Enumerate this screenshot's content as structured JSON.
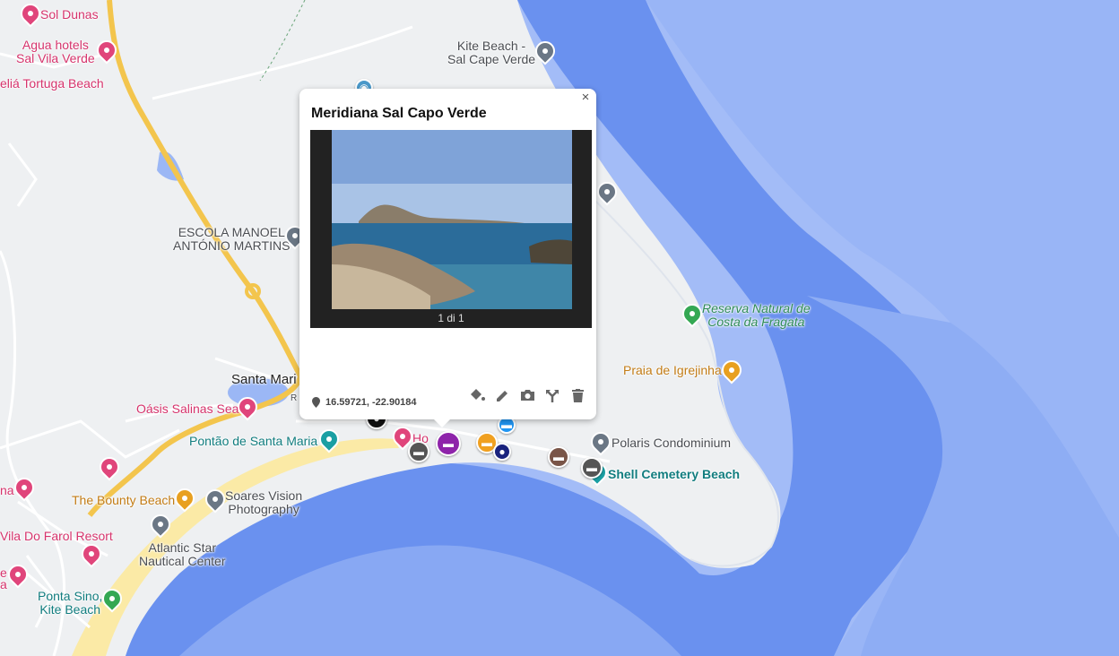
{
  "popup": {
    "title": "Meridiana Sal Capo Verde",
    "photo_counter": "1 di 1",
    "coordinates": "16.59721, -22.90184",
    "close_symbol": "×",
    "toolbar_icons": [
      "paint-bucket-icon",
      "pencil-icon",
      "camera-icon",
      "directions-icon",
      "trash-icon"
    ]
  },
  "places": {
    "sol_dunas": "Sol Dunas",
    "agua_hotels_1": "Agua hotels",
    "agua_hotels_2": "Sal Vila Verde",
    "melia_tortuga": "eliá Tortuga Beach",
    "kite_beach_1": "Kite Beach -",
    "kite_beach_2": "Sal Cape Verde",
    "escola_1": "ESCOLA MANOEL",
    "escola_2": "ANTÓNIO MARTINS",
    "reserva_1": "Reserva Natural de",
    "reserva_2": "Costa da Fragata",
    "praia_igrejinha": "Praia de Igrejinha",
    "santa_maria": "Santa Mari",
    "santa_maria_r": "R",
    "oasis": "Oásis Salinas Sea",
    "pontao": "Pontão de Santa Maria",
    "polaris": "Polaris Condominium",
    "shell": "Shell Cemetery Beach",
    "hotel_partial": "Ho",
    "edge_na": "na",
    "bounty": "The Bounty Beach",
    "soares_1": "Soares Vision",
    "soares_2": "Photography",
    "vila_farol": "Vila Do Farol Resort",
    "atlantic_1": "Atlantic Star",
    "atlantic_2": "Nautical Center",
    "edge_e": "e",
    "edge_a": "a",
    "ponta_sino_1": "Ponta Sino,",
    "ponta_sino_2": "Kite Beach"
  },
  "colors": {
    "land": "#eef0f2",
    "shallow_water": "#9bb7f5",
    "deep_water": "#6f95f0",
    "ocean_far": "#a3bcf7",
    "road_yellow": "#f3c54d",
    "beach": "#fbeaa6",
    "hotel_pin": "#e0457b",
    "poi_grey": "#6b7785",
    "park_green": "#34a853",
    "bar_orange": "#e8a020",
    "teal": "#117d7f"
  }
}
